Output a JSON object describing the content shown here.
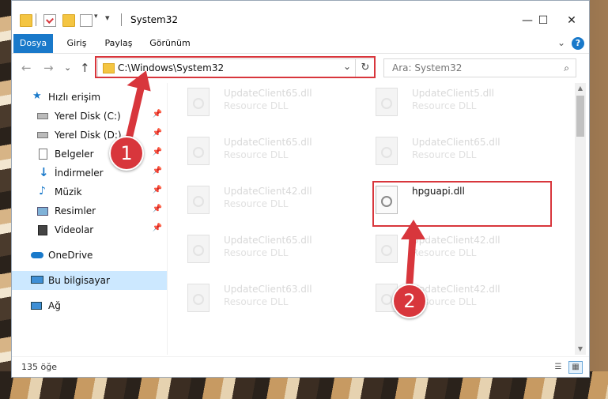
{
  "window": {
    "title": "System32",
    "controls": {
      "minimize": "—",
      "maximize": "☐",
      "close": "✕"
    }
  },
  "ribbon": {
    "tabs": [
      "Dosya",
      "Giriş",
      "Paylaş",
      "Görünüm"
    ],
    "active_tab": "Dosya",
    "help": "?",
    "collapse": "⌄"
  },
  "address": {
    "path": "C:\\Windows\\System32",
    "refresh_icon": "↻",
    "dropdown_icon": "⌄"
  },
  "search": {
    "placeholder": "Ara: System32",
    "icon": "⌕"
  },
  "nav_buttons": {
    "back": "←",
    "forward": "→",
    "recent": "⌄",
    "up": "↑"
  },
  "sidebar": {
    "items": [
      {
        "label": "Hızlı erişim",
        "icon": "star-icon"
      },
      {
        "label": "Yerel Disk (C:)",
        "icon": "drive-icon",
        "pinned": true
      },
      {
        "label": "Yerel Disk (D:)",
        "icon": "drive-icon",
        "pinned": true
      },
      {
        "label": "Belgeler",
        "icon": "document-icon",
        "pinned": true
      },
      {
        "label": "İndirmeler",
        "icon": "download-icon",
        "pinned": true
      },
      {
        "label": "Müzik",
        "icon": "music-icon",
        "pinned": true
      },
      {
        "label": "Resimler",
        "icon": "picture-icon",
        "pinned": true
      },
      {
        "label": "Videolar",
        "icon": "video-icon",
        "pinned": true
      },
      {
        "label": "OneDrive",
        "icon": "cloud-icon"
      },
      {
        "label": "Bu bilgisayar",
        "icon": "computer-icon",
        "selected": true
      },
      {
        "label": "Ağ",
        "icon": "network-icon"
      }
    ],
    "pin_glyph": "📌"
  },
  "files": [
    {
      "name": "UpdateClient65.dll",
      "type": "Resource DLL"
    },
    {
      "name": "UpdateClient5.dll",
      "type": "Resource DLL"
    },
    {
      "name": "UpdateClient65.dll",
      "type": "Resource DLL"
    },
    {
      "name": "UpdateClient65.dll",
      "type": "Resource DLL"
    },
    {
      "name": "UpdateClient42.dll",
      "type": "Resource DLL"
    },
    {
      "name": "hpguapi.dll",
      "type": "",
      "highlighted": true
    },
    {
      "name": "UpdateClient65.dll",
      "type": "Resource DLL"
    },
    {
      "name": "UpdateClient42.dll",
      "type": "Resource DLL"
    },
    {
      "name": "UpdateClient63.dll",
      "type": "Resource DLL"
    },
    {
      "name": "UpdateClient42.dll",
      "type": "Resource DLL"
    }
  ],
  "status": {
    "count": "135 öğe"
  },
  "markers": {
    "step1": "1",
    "step2": "2"
  },
  "colors": {
    "accent": "#1979ca",
    "highlight": "#d8363c",
    "selected": "#cce8ff"
  }
}
